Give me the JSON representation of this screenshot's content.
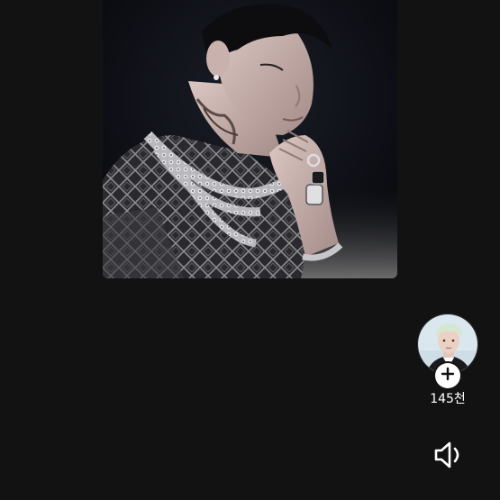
{
  "follower_count": "145천",
  "icons": {
    "follow": "plus-icon",
    "sound": "speaker-icon"
  },
  "colors": {
    "background": "#121212",
    "text": "#ffffff"
  }
}
